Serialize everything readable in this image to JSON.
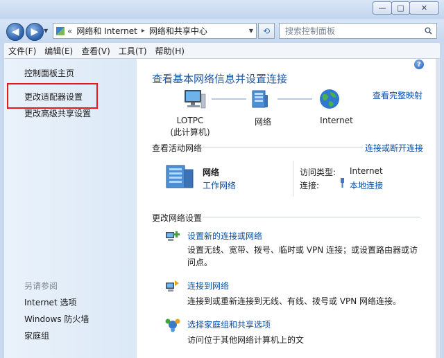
{
  "window": {
    "minimize_glyph": "—",
    "maximize_glyph": "□",
    "close_glyph": "✕"
  },
  "nav": {
    "back_glyph": "◀",
    "forward_glyph": "▶",
    "address_chevron": "«",
    "breadcrumb": [
      "网络和 Internet",
      "网络和共享中心"
    ],
    "separator": "▸",
    "search_placeholder": "搜索控制面板"
  },
  "menu": [
    "文件(F)",
    "编辑(E)",
    "查看(V)",
    "工具(T)",
    "帮助(H)"
  ],
  "sidebar": {
    "home": "控制面板主页",
    "items": [
      "更改适配器设置",
      "更改高级共享设置"
    ],
    "see_also_title": "另请参阅",
    "see_also": [
      "Internet 选项",
      "Windows 防火墙",
      "家庭组"
    ]
  },
  "main": {
    "title": "查看基本网络信息并设置连接",
    "full_map": "查看完整映射",
    "nodes": [
      {
        "label": "LOTPC",
        "sub": "(此计算机)"
      },
      {
        "label": "网络",
        "sub": ""
      },
      {
        "label": "Internet",
        "sub": ""
      }
    ],
    "active_header": "查看活动网络",
    "connect_link": "连接或断开连接",
    "network_name": "网络",
    "network_type": "工作网络",
    "access_type_label": "访问类型:",
    "access_type_value": "Internet",
    "connection_label": "连接:",
    "connection_value": "本地连接",
    "change_header": "更改网络设置",
    "tasks": [
      {
        "title": "设置新的连接或网络",
        "desc": "设置无线、宽带、拨号、临时或 VPN 连接；或设置路由器或访问点。"
      },
      {
        "title": "连接到网络",
        "desc": "连接到或重新连接到无线、有线、拨号或 VPN 网络连接。"
      },
      {
        "title": "选择家庭组和共享选项",
        "desc": "访问位于其他网络计算机上的文"
      }
    ]
  },
  "help_glyph": "?",
  "colors": {
    "link": "#0b4fa6",
    "title": "#1a56a6",
    "highlight": "#e81818"
  }
}
